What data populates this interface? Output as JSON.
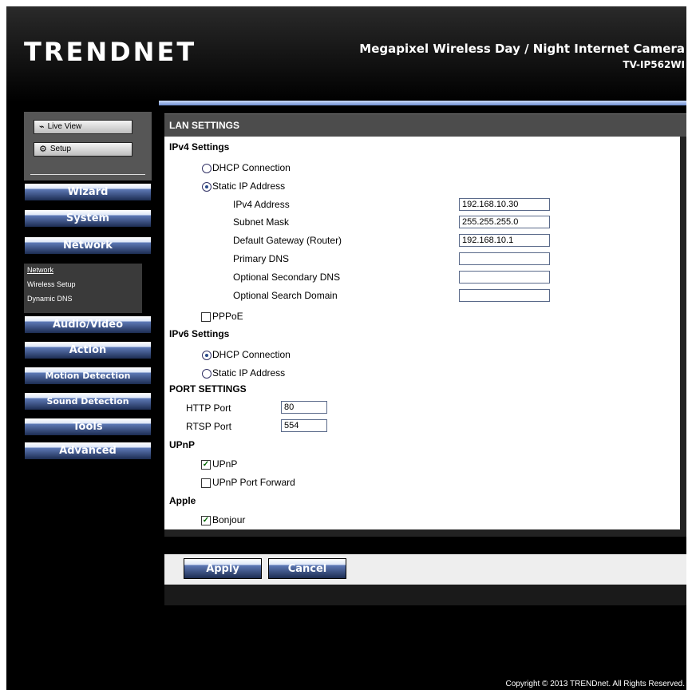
{
  "header": {
    "logo": "TRENDNET",
    "product_title": "Megapixel Wireless Day / Night Internet Camera",
    "product_model": "TV-IP562WI"
  },
  "sidebar": {
    "live_view_label": "Live View",
    "setup_label": "Setup",
    "nav": [
      "Wizard",
      "System",
      "Network",
      "Audio/Video",
      "Action",
      "Motion Detection",
      "Sound Detection",
      "Tools",
      "Advanced"
    ],
    "subnav": [
      "Network",
      "Wireless Setup",
      "Dynamic DNS"
    ]
  },
  "panel": {
    "title": "LAN SETTINGS",
    "ipv4": {
      "section": "IPv4 Settings",
      "dhcp_label": "DHCP Connection",
      "static_label": "Static IP Address",
      "selected": "static",
      "fields": [
        {
          "label": "IPv4 Address",
          "value": "192.168.10.30"
        },
        {
          "label": "Subnet Mask",
          "value": "255.255.255.0"
        },
        {
          "label": "Default Gateway (Router)",
          "value": "192.168.10.1"
        },
        {
          "label": "Primary DNS",
          "value": ""
        },
        {
          "label": "Optional Secondary DNS",
          "value": ""
        },
        {
          "label": "Optional Search Domain",
          "value": ""
        }
      ],
      "pppoe_label": "PPPoE",
      "pppoe_checked": false
    },
    "ipv6": {
      "section": "IPv6 Settings",
      "dhcp_label": "DHCP Connection",
      "static_label": "Static IP Address",
      "selected": "dhcp"
    },
    "ports": {
      "section": "PORT SETTINGS",
      "http_label": "HTTP Port",
      "http_value": "80",
      "rtsp_label": "RTSP Port",
      "rtsp_value": "554"
    },
    "upnp": {
      "section": "UPnP",
      "upnp_label": "UPnP",
      "upnp_checked": true,
      "forward_label": "UPnP Port Forward",
      "forward_checked": false
    },
    "apple": {
      "section": "Apple",
      "bonjour_label": "Bonjour",
      "bonjour_checked": true
    }
  },
  "actions": {
    "apply": "Apply",
    "cancel": "Cancel"
  },
  "footer": {
    "copyright": "Copyright © 2013 TRENDnet. All Rights Reserved."
  }
}
